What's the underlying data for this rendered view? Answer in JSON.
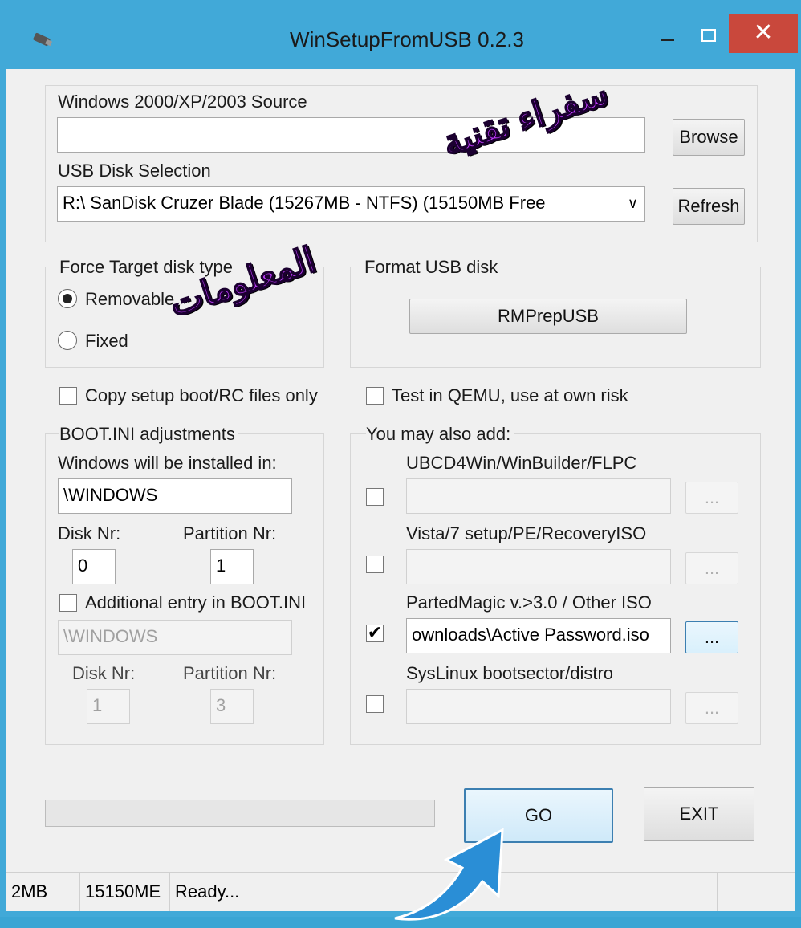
{
  "window": {
    "title": "WinSetupFromUSB 0.2.3",
    "close_glyph": "✕"
  },
  "source": {
    "label": "Windows 2000/XP/2003 Source",
    "value": "",
    "browse_label": "Browse"
  },
  "usb": {
    "label": "USB Disk Selection",
    "value": "R:\\ SanDisk Cruzer Blade (15267MB - NTFS) (15150MB Free",
    "refresh_label": "Refresh"
  },
  "force_target": {
    "label": "Force Target disk type",
    "options": [
      "Removable",
      "Fixed"
    ],
    "selected": "Removable"
  },
  "format_usb": {
    "label": "Format USB disk",
    "button_label": "RMPrepUSB"
  },
  "copy_setup_boot": {
    "label": "Copy setup boot/RC files only",
    "checked": false
  },
  "test_qemu": {
    "label": "Test in QEMU, use at own risk",
    "checked": false
  },
  "boot_ini": {
    "group_label": "BOOT.INI adjustments",
    "install_label": "Windows will be installed in:",
    "install_value": "\\WINDOWS",
    "disk_label": "Disk Nr:",
    "disk_value": "0",
    "partition_label": "Partition Nr:",
    "partition_value": "1",
    "additional_label": "Additional entry in BOOT.INI",
    "additional_checked": false,
    "additional_path": "\\WINDOWS",
    "additional_disk_label": "Disk Nr:",
    "additional_disk_value": "1",
    "additional_partition_label": "Partition Nr:",
    "additional_partition_value": "3"
  },
  "also_add": {
    "label": "You may also add:",
    "items": [
      {
        "label": "UBCD4Win/WinBuilder/FLPC",
        "checked": false,
        "path": "",
        "browse": "..."
      },
      {
        "label": "Vista/7 setup/PE/RecoveryISO",
        "checked": false,
        "path": "",
        "browse": "..."
      },
      {
        "label": "PartedMagic v.>3.0 / Other ISO",
        "checked": true,
        "path": "ownloads\\Active Password.iso",
        "browse": "..."
      },
      {
        "label": "SysLinux bootsector/distro",
        "checked": false,
        "path": "",
        "browse": "..."
      }
    ]
  },
  "progress": {
    "value": 0
  },
  "go_label": "GO",
  "exit_label": "EXIT",
  "status": {
    "size": "2MB",
    "free": "15150ME",
    "state": "Ready..."
  },
  "watermark": {
    "line1": "سفراء تقنية",
    "line2": "المعلومات"
  },
  "colors": {
    "title_bar": "#41a9d8",
    "close_button": "#c9483c",
    "watermark": "#c13aff",
    "arrow": "#2a8ed6"
  },
  "icons": [
    "usb-drive-icon",
    "minimize-icon",
    "maximize-icon",
    "close-icon",
    "radio-icon",
    "checkbox-icon",
    "checkmark-icon",
    "dropdown-arrow-icon",
    "pointer-arrow-icon"
  ]
}
